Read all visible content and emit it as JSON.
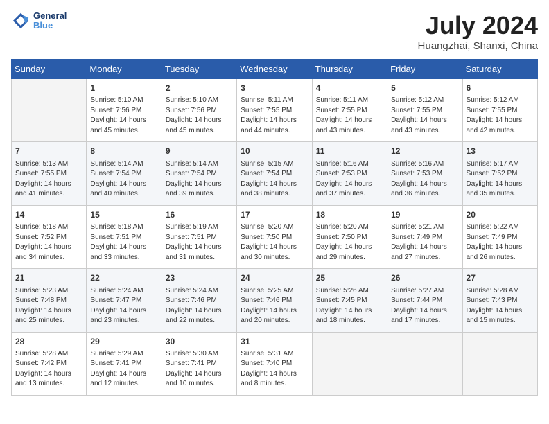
{
  "header": {
    "logo_line1": "General",
    "logo_line2": "Blue",
    "month": "July 2024",
    "location": "Huangzhai, Shanxi, China"
  },
  "days_of_week": [
    "Sunday",
    "Monday",
    "Tuesday",
    "Wednesday",
    "Thursday",
    "Friday",
    "Saturday"
  ],
  "weeks": [
    [
      {
        "num": "",
        "info": ""
      },
      {
        "num": "1",
        "info": "Sunrise: 5:10 AM\nSunset: 7:56 PM\nDaylight: 14 hours\nand 45 minutes."
      },
      {
        "num": "2",
        "info": "Sunrise: 5:10 AM\nSunset: 7:56 PM\nDaylight: 14 hours\nand 45 minutes."
      },
      {
        "num": "3",
        "info": "Sunrise: 5:11 AM\nSunset: 7:55 PM\nDaylight: 14 hours\nand 44 minutes."
      },
      {
        "num": "4",
        "info": "Sunrise: 5:11 AM\nSunset: 7:55 PM\nDaylight: 14 hours\nand 43 minutes."
      },
      {
        "num": "5",
        "info": "Sunrise: 5:12 AM\nSunset: 7:55 PM\nDaylight: 14 hours\nand 43 minutes."
      },
      {
        "num": "6",
        "info": "Sunrise: 5:12 AM\nSunset: 7:55 PM\nDaylight: 14 hours\nand 42 minutes."
      }
    ],
    [
      {
        "num": "7",
        "info": "Sunrise: 5:13 AM\nSunset: 7:55 PM\nDaylight: 14 hours\nand 41 minutes."
      },
      {
        "num": "8",
        "info": "Sunrise: 5:14 AM\nSunset: 7:54 PM\nDaylight: 14 hours\nand 40 minutes."
      },
      {
        "num": "9",
        "info": "Sunrise: 5:14 AM\nSunset: 7:54 PM\nDaylight: 14 hours\nand 39 minutes."
      },
      {
        "num": "10",
        "info": "Sunrise: 5:15 AM\nSunset: 7:54 PM\nDaylight: 14 hours\nand 38 minutes."
      },
      {
        "num": "11",
        "info": "Sunrise: 5:16 AM\nSunset: 7:53 PM\nDaylight: 14 hours\nand 37 minutes."
      },
      {
        "num": "12",
        "info": "Sunrise: 5:16 AM\nSunset: 7:53 PM\nDaylight: 14 hours\nand 36 minutes."
      },
      {
        "num": "13",
        "info": "Sunrise: 5:17 AM\nSunset: 7:52 PM\nDaylight: 14 hours\nand 35 minutes."
      }
    ],
    [
      {
        "num": "14",
        "info": "Sunrise: 5:18 AM\nSunset: 7:52 PM\nDaylight: 14 hours\nand 34 minutes."
      },
      {
        "num": "15",
        "info": "Sunrise: 5:18 AM\nSunset: 7:51 PM\nDaylight: 14 hours\nand 33 minutes."
      },
      {
        "num": "16",
        "info": "Sunrise: 5:19 AM\nSunset: 7:51 PM\nDaylight: 14 hours\nand 31 minutes."
      },
      {
        "num": "17",
        "info": "Sunrise: 5:20 AM\nSunset: 7:50 PM\nDaylight: 14 hours\nand 30 minutes."
      },
      {
        "num": "18",
        "info": "Sunrise: 5:20 AM\nSunset: 7:50 PM\nDaylight: 14 hours\nand 29 minutes."
      },
      {
        "num": "19",
        "info": "Sunrise: 5:21 AM\nSunset: 7:49 PM\nDaylight: 14 hours\nand 27 minutes."
      },
      {
        "num": "20",
        "info": "Sunrise: 5:22 AM\nSunset: 7:49 PM\nDaylight: 14 hours\nand 26 minutes."
      }
    ],
    [
      {
        "num": "21",
        "info": "Sunrise: 5:23 AM\nSunset: 7:48 PM\nDaylight: 14 hours\nand 25 minutes."
      },
      {
        "num": "22",
        "info": "Sunrise: 5:24 AM\nSunset: 7:47 PM\nDaylight: 14 hours\nand 23 minutes."
      },
      {
        "num": "23",
        "info": "Sunrise: 5:24 AM\nSunset: 7:46 PM\nDaylight: 14 hours\nand 22 minutes."
      },
      {
        "num": "24",
        "info": "Sunrise: 5:25 AM\nSunset: 7:46 PM\nDaylight: 14 hours\nand 20 minutes."
      },
      {
        "num": "25",
        "info": "Sunrise: 5:26 AM\nSunset: 7:45 PM\nDaylight: 14 hours\nand 18 minutes."
      },
      {
        "num": "26",
        "info": "Sunrise: 5:27 AM\nSunset: 7:44 PM\nDaylight: 14 hours\nand 17 minutes."
      },
      {
        "num": "27",
        "info": "Sunrise: 5:28 AM\nSunset: 7:43 PM\nDaylight: 14 hours\nand 15 minutes."
      }
    ],
    [
      {
        "num": "28",
        "info": "Sunrise: 5:28 AM\nSunset: 7:42 PM\nDaylight: 14 hours\nand 13 minutes."
      },
      {
        "num": "29",
        "info": "Sunrise: 5:29 AM\nSunset: 7:41 PM\nDaylight: 14 hours\nand 12 minutes."
      },
      {
        "num": "30",
        "info": "Sunrise: 5:30 AM\nSunset: 7:41 PM\nDaylight: 14 hours\nand 10 minutes."
      },
      {
        "num": "31",
        "info": "Sunrise: 5:31 AM\nSunset: 7:40 PM\nDaylight: 14 hours\nand 8 minutes."
      },
      {
        "num": "",
        "info": ""
      },
      {
        "num": "",
        "info": ""
      },
      {
        "num": "",
        "info": ""
      }
    ]
  ]
}
